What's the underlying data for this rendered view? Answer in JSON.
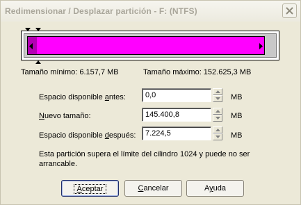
{
  "window": {
    "title": "Redimensionar / Desplazar partición - F:  (NTFS)"
  },
  "partition_bar": {
    "fill_color": "#ff00ff",
    "used_color": "#b400b4",
    "free_color": "#c8c8c8"
  },
  "sizes": {
    "min_label": "Tamaño mínimo: 6.157,7 MB",
    "max_label": "Tamaño máximo: 152.625,3 MB"
  },
  "fields": {
    "before": {
      "label_pre": "Espacio disponible ",
      "label_key": "a",
      "label_post": "ntes:",
      "value": "0,0",
      "unit": "MB"
    },
    "new_size": {
      "label_pre": "",
      "label_key": "N",
      "label_post": "uevo tamaño:",
      "value": "145.400,8",
      "unit": "MB"
    },
    "after": {
      "label_pre": "Espacio disponible ",
      "label_key": "d",
      "label_post": "espués:",
      "value": "7.224,5",
      "unit": "MB"
    }
  },
  "warning": "Esta partición supera el límite del cilindro 1024 y puede no ser arrancable.",
  "buttons": {
    "ok": {
      "key": "A",
      "rest": "ceptar"
    },
    "cancel": {
      "key": "C",
      "rest": "ancelar"
    },
    "help": {
      "key": "y",
      "pre": "A",
      "rest": "uda"
    }
  }
}
